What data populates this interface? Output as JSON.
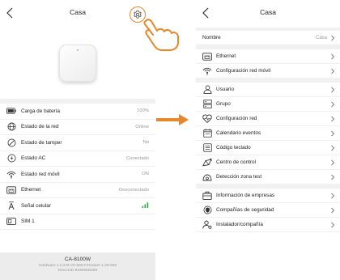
{
  "left": {
    "title": "Casa",
    "status_rows": [
      {
        "label": "Carga de batería",
        "value": "100%",
        "icon": "battery-icon"
      },
      {
        "label": "Estado de la red",
        "value": "Online",
        "icon": "globe-icon"
      },
      {
        "label": "Estado de tamper",
        "value": "No",
        "icon": "tamper-icon"
      },
      {
        "label": "Estado AC",
        "value": "Conectado",
        "icon": "power-icon"
      },
      {
        "label": "Estado red móvil",
        "value": "ON",
        "icon": "mobile-signal-icon"
      },
      {
        "label": "Ethernet",
        "value": "Desconectado",
        "icon": "ethernet-icon"
      },
      {
        "label": "Señal celular",
        "value": "",
        "icon": "antenna-icon"
      },
      {
        "label": "SIM 1",
        "value": "",
        "icon": "sim-icon"
      }
    ],
    "signal_color": "#35a845",
    "footer": {
      "model": "CA-8100W",
      "hardware": "Hardware 1.0.3-B-V0-868,Firmware 1.25-002",
      "device_id": "DeviceID 819080D089"
    }
  },
  "right": {
    "title": "Casa",
    "groups": [
      [
        {
          "label": "Nombre",
          "value": "Casa",
          "icon": ""
        }
      ],
      [
        {
          "label": "Ethernet",
          "value": "",
          "icon": "ethernet-icon"
        },
        {
          "label": "Configuración red móvil",
          "value": "",
          "icon": "mobile-signal-icon"
        }
      ],
      [
        {
          "label": "Usuario",
          "value": "",
          "icon": "user-icon"
        },
        {
          "label": "Grupo",
          "value": "",
          "icon": "group-icon"
        },
        {
          "label": "Configuración red",
          "value": "",
          "icon": "network-config-icon"
        },
        {
          "label": "Calendario eventos",
          "value": "",
          "icon": "calendar-icon"
        },
        {
          "label": "Código teclado",
          "value": "",
          "icon": "keypad-icon"
        },
        {
          "label": "Centro de control",
          "value": "",
          "icon": "control-center-icon"
        },
        {
          "label": "Detección zona test",
          "value": "",
          "icon": "zone-test-icon"
        }
      ],
      [
        {
          "label": "Información de empresas",
          "value": "",
          "icon": "company-icon"
        },
        {
          "label": "Compañías de seguridad",
          "value": "",
          "icon": "security-icon"
        },
        {
          "label": "Instalador/compañía",
          "value": "",
          "icon": "installer-icon"
        }
      ]
    ]
  },
  "accent_color": "#e8862a"
}
